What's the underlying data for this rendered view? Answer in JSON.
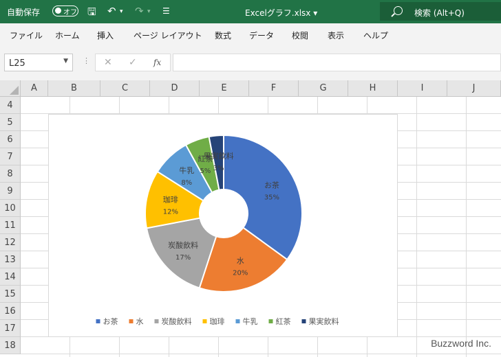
{
  "titlebar": {
    "autosave_label": "自動保存",
    "autosave_state": "オフ",
    "doc_title": "Excelグラフ.xlsx ▾",
    "search_label": "検索 (Alt+Q)"
  },
  "ribbon": {
    "tabs": [
      "ファイル",
      "ホーム",
      "挿入",
      "ページ レイアウト",
      "数式",
      "データ",
      "校閲",
      "表示",
      "ヘルプ"
    ]
  },
  "formula_bar": {
    "name_box": "L25",
    "fx": "fx",
    "cancel": "✕",
    "enter": "✓"
  },
  "columns": [
    "A",
    "B",
    "C",
    "D",
    "E",
    "F",
    "G",
    "H",
    "I",
    "J"
  ],
  "rows": [
    "4",
    "5",
    "6",
    "7",
    "8",
    "9",
    "10",
    "11",
    "12",
    "13",
    "14",
    "15",
    "16",
    "17",
    "18"
  ],
  "chart_data": {
    "type": "pie",
    "variant": "doughnut",
    "title": "",
    "categories": [
      "お茶",
      "水",
      "炭酸飲料",
      "珈琲",
      "牛乳",
      "紅茶",
      "果実飲料"
    ],
    "values": [
      35,
      20,
      17,
      12,
      8,
      5,
      3
    ],
    "labels": [
      "35%",
      "20%",
      "17%",
      "12%",
      "8%",
      "5%",
      "3%"
    ],
    "colors": [
      "#4472C4",
      "#ED7D31",
      "#A5A5A5",
      "#FFC000",
      "#5B9BD5",
      "#70AD47",
      "#264478"
    ],
    "legend": "bottom"
  },
  "watermark": "Buzzword Inc."
}
